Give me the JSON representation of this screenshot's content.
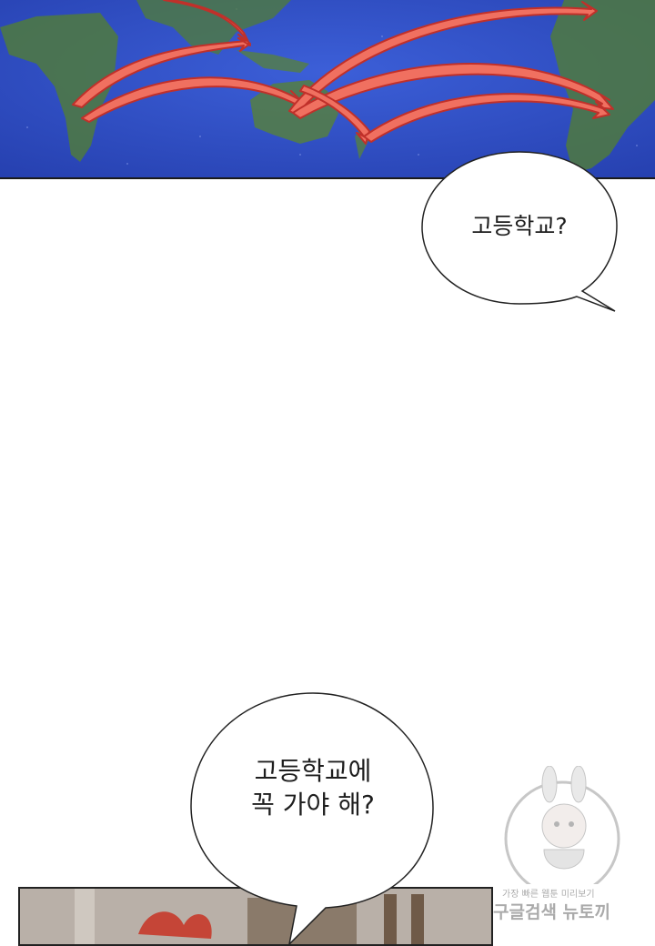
{
  "colors": {
    "ocean": "#2f4fc4",
    "land": "#4f7a3e",
    "arrow_fill": "#f07060",
    "arrow_stroke": "#c0302a",
    "sfx": "#c63a2a"
  },
  "panels": {
    "map": {
      "icon": "world-map-icon"
    },
    "scene": {
      "sfx_text": ""
    }
  },
  "bubbles": [
    {
      "text": "고등학교?"
    },
    {
      "text": "고등학교에\n꼭 가야 해?"
    }
  ],
  "watermark": {
    "line1": "가장 빠른 웹툰 미리보기",
    "line2": "구글검색 뉴토끼",
    "icon": "rabbit-mascot-icon"
  }
}
